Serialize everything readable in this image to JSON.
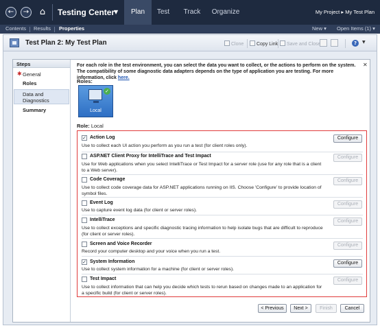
{
  "topbar": {
    "app_name": "Testing Center",
    "tabs": [
      "Plan",
      "Test",
      "Track",
      "Organize"
    ],
    "project_link": "My Project ▸ My Test Plan"
  },
  "subbar": {
    "items": [
      "Contents",
      "Results",
      "Properties"
    ],
    "new_label": "New ▾",
    "open_items_label": "Open Items (1) ▾"
  },
  "window": {
    "title": "Test Plan 2: My Test Plan",
    "toolbar": {
      "clone": "Clone",
      "copy_link": "Copy Link",
      "save_and_close": "Save and Close"
    }
  },
  "steps": {
    "header": "Steps",
    "items": [
      "General",
      "Roles",
      "Data and",
      "Diagnostics",
      "Summary"
    ]
  },
  "content": {
    "intro": "For each role in the test environment, you can select the data you want to collect, or the actions to perform on the system. The compatibility of some diagnostic data adapters depends on the type of application you are testing. For more information, click",
    "intro_link": "here.",
    "roles_label": "Roles:",
    "role_tile": "Local",
    "role_prefix": "Role:",
    "role_value": "Local"
  },
  "adapters": [
    {
      "name": "Action Log",
      "checked": true,
      "desc": "Use to collect each UI action you perform as you run a test (for client roles only).",
      "configure": "Configure",
      "configure_enabled": true
    },
    {
      "name": "ASP.NET Client Proxy for IntelliTrace and Test Impact",
      "checked": false,
      "desc": "Use for Web applications when you select IntelliTrace or Test Impact for a server role (use for any role that is a client to a Web server).",
      "configure": "Configure",
      "configure_enabled": false
    },
    {
      "name": "Code Coverage",
      "checked": false,
      "desc": "Use to collect code coverage data for ASP.NET applications running on IIS. Choose 'Configure' to provide location of symbol files.",
      "configure": "Configure",
      "configure_enabled": false
    },
    {
      "name": "Event Log",
      "checked": false,
      "desc": "Use to capture event log data (for client or server roles).",
      "configure": "Configure",
      "configure_enabled": false
    },
    {
      "name": "IntelliTrace",
      "checked": false,
      "desc": "Use to collect exceptions and specific diagnostic tracing information to help isolate bugs that are difficult to reproduce (for client or server roles).",
      "configure": "Configure",
      "configure_enabled": false
    },
    {
      "name": "Screen and Voice Recorder",
      "checked": false,
      "desc": "Record your computer desktop and your voice when you run a test.",
      "configure": "Configure",
      "configure_enabled": false
    },
    {
      "name": "System Information",
      "checked": true,
      "desc": "Use to collect system information for a machine (for client or server roles).",
      "configure": "Configure",
      "configure_enabled": true
    },
    {
      "name": "Test Impact",
      "checked": false,
      "desc": "Use to collect information that can help you decide which tests to rerun based on changes made to an application for a specific build (for client or server roles).",
      "configure": "Configure",
      "configure_enabled": false
    }
  ],
  "footer": {
    "previous": "< Previous",
    "next": "Next >",
    "finish": "Finish",
    "cancel": "Cancel"
  }
}
